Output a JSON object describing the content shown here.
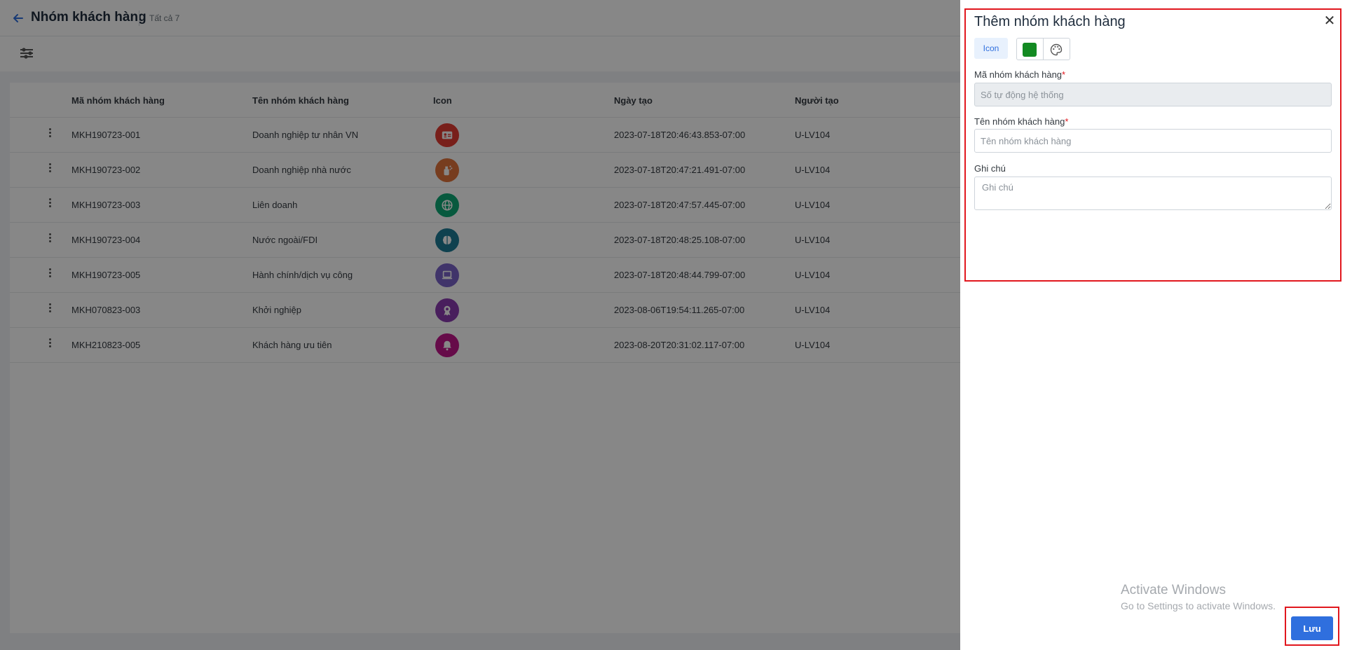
{
  "header": {
    "back_icon": "arrow-left-icon",
    "title": "Nhóm khách hàng",
    "count": "Tất cả 7"
  },
  "toolbar": {
    "filter_icon": "sliders-icon"
  },
  "table": {
    "columns": [
      "Mã nhóm khách hàng",
      "Tên nhóm khách hàng",
      "Icon",
      "Ngày tạo",
      "Người tạo"
    ],
    "rows": [
      {
        "code": "MKH190723-001",
        "name": "Doanh nghiệp tư nhân VN",
        "icon": "id-card-icon",
        "icon_color": "#e33b31",
        "created": "2023-07-18T20:46:43.853-07:00",
        "creator": "U-LV104"
      },
      {
        "code": "MKH190723-002",
        "name": "Doanh nghiệp nhà nước",
        "icon": "spray-bottle-icon",
        "icon_color": "#e0733c",
        "created": "2023-07-18T20:47:21.491-07:00",
        "creator": "U-LV104"
      },
      {
        "code": "MKH190723-003",
        "name": "Liên doanh",
        "icon": "globe-icon",
        "icon_color": "#0fa876",
        "created": "2023-07-18T20:47:57.445-07:00",
        "creator": "U-LV104"
      },
      {
        "code": "MKH190723-004",
        "name": "Nước ngoài/FDI",
        "icon": "brain-icon",
        "icon_color": "#1d7b96",
        "created": "2023-07-18T20:48:25.108-07:00",
        "creator": "U-LV104"
      },
      {
        "code": "MKH190723-005",
        "name": "Hành chính/dịch vụ công",
        "icon": "laptop-icon",
        "icon_color": "#7a63c9",
        "created": "2023-07-18T20:48:44.799-07:00",
        "creator": "U-LV104"
      },
      {
        "code": "MKH070823-003",
        "name": "Khởi nghiệp",
        "icon": "award-icon",
        "icon_color": "#8a3bb0",
        "created": "2023-08-06T19:54:11.265-07:00",
        "creator": "U-LV104"
      },
      {
        "code": "MKH210823-005",
        "name": "Khách hàng ưu tiên",
        "icon": "bell-icon",
        "icon_color": "#c1168a",
        "created": "2023-08-20T20:31:02.117-07:00",
        "creator": "U-LV104"
      }
    ]
  },
  "panel": {
    "title": "Thêm nhóm khách hàng",
    "close_icon": "close-icon",
    "icon_tab_label": "Icon",
    "selected_color": "#138a22",
    "palette_icon": "palette-icon",
    "code_label": "Mã nhóm khách hàng",
    "code_placeholder": "Số tự động hệ thống",
    "name_label": "Tên nhóm khách hàng",
    "name_placeholder": "Tên nhóm khách hàng",
    "note_label": "Ghi chú",
    "note_placeholder": "Ghi chú",
    "required_mark": "*",
    "save_label": "Lưu"
  },
  "watermark": {
    "title": "Activate Windows",
    "subtitle": "Go to Settings to activate Windows."
  }
}
